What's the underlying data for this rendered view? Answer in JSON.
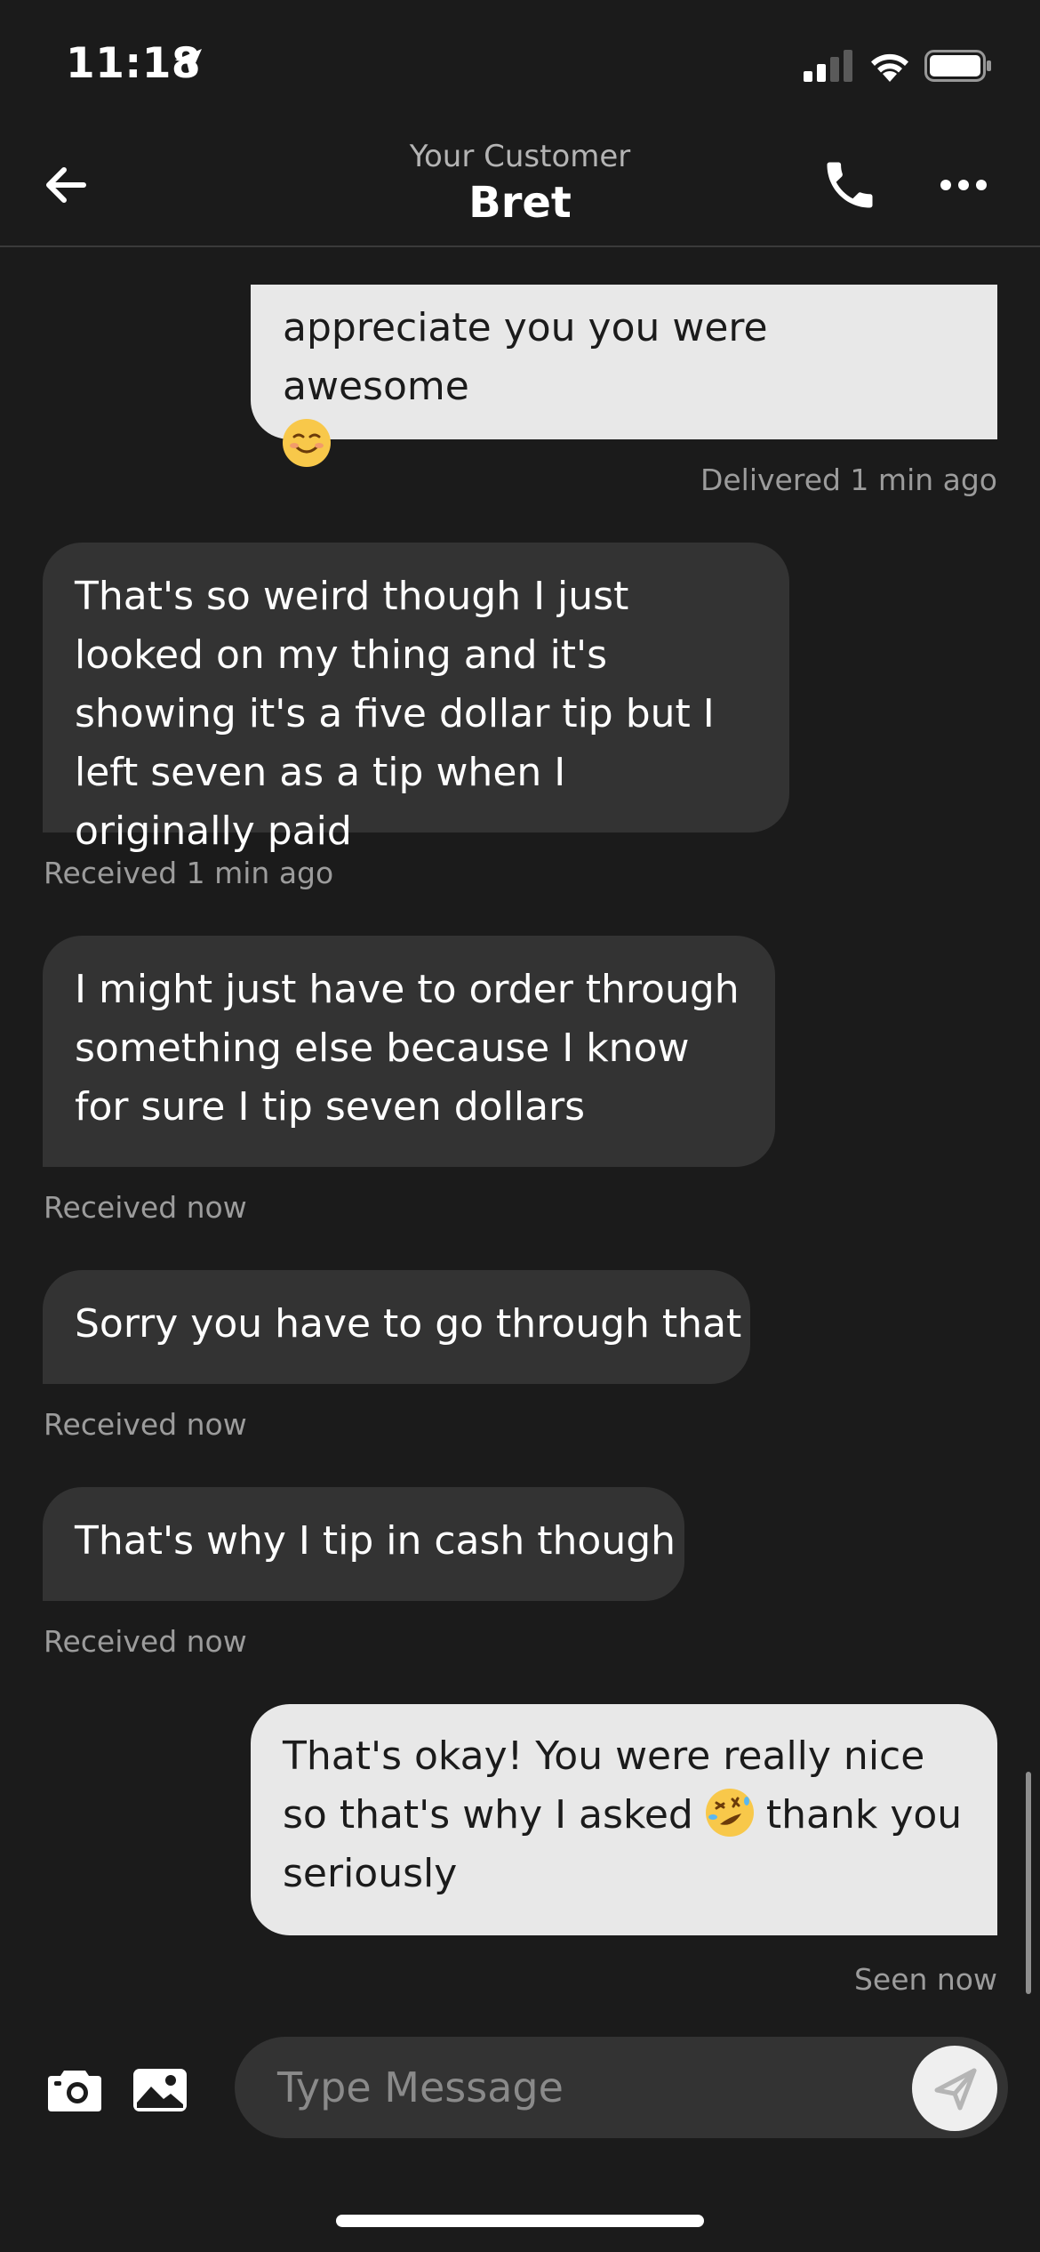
{
  "status_bar": {
    "time": "11:18"
  },
  "header": {
    "subtitle": "Your Customer",
    "title": "Bret"
  },
  "messages": [
    {
      "from": "me",
      "text": "appreciate you you were awesome",
      "status": "Delivered 1 min ago"
    },
    {
      "from": "customer",
      "text": "That's so weird though I just looked on my thing and it's showing it's a five dollar tip but I left seven as a tip when I originally paid",
      "status": "Received 1 min ago"
    },
    {
      "from": "customer",
      "text": "I might just have to order through something else because I know for sure I tip seven dollars",
      "status": "Received now"
    },
    {
      "from": "customer",
      "text": "Sorry you have to go through that",
      "status": "Received now"
    },
    {
      "from": "customer",
      "text": "That's why I tip in cash though",
      "status": "Received now"
    },
    {
      "from": "me",
      "text_before": "That's okay! You were really nice so that's why I asked",
      "text_after": "thank you seriously",
      "status": "Seen now"
    }
  ],
  "input": {
    "placeholder": "Type Message"
  },
  "icons": {
    "back": "arrow-left-icon",
    "phone": "phone-icon",
    "more": "more-horizontal-icon",
    "camera": "camera-icon",
    "gallery": "image-icon",
    "send": "send-icon",
    "emoji_1": "smiling-face-icon",
    "emoji_2": "rolling-laughing-icon"
  }
}
